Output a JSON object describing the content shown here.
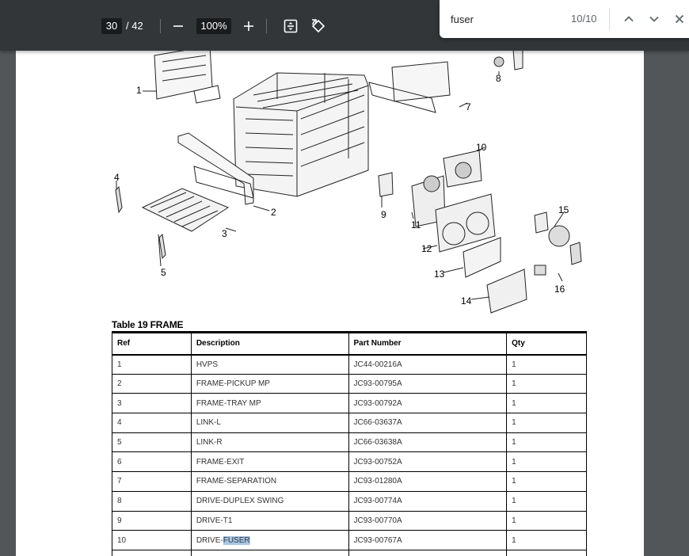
{
  "toolbar": {
    "page_current": "30",
    "page_total": "/ 42",
    "zoom": "100%",
    "icons": [
      "zoom-out-icon",
      "zoom-in-icon",
      "fit-page-icon",
      "rotate-icon"
    ]
  },
  "find": {
    "query": "fuser",
    "count": "10/10",
    "icons": [
      "chevron-up-icon",
      "chevron-down-icon",
      "close-icon"
    ]
  },
  "diagram": {
    "callouts": [
      "1",
      "2",
      "3",
      "4",
      "5",
      "7",
      "8",
      "9",
      "10",
      "11",
      "12",
      "13",
      "14",
      "15",
      "16"
    ]
  },
  "table": {
    "caption": "Table 19  FRAME",
    "headers": [
      "Ref",
      "Description",
      "Part Number",
      "Qty"
    ],
    "rows": [
      {
        "ref": "1",
        "desc": "HVPS",
        "part": "JC44-00216A",
        "qty": "1"
      },
      {
        "ref": "2",
        "desc": "FRAME-PICKUP MP",
        "part": "JC93-00795A",
        "qty": "1"
      },
      {
        "ref": "3",
        "desc": "FRAME-TRAY MP",
        "part": "JC93-00792A",
        "qty": "1"
      },
      {
        "ref": "4",
        "desc": "LINK-L",
        "part": "JC66-03637A",
        "qty": "1"
      },
      {
        "ref": "5",
        "desc": "LINK-R",
        "part": "JC66-03638A",
        "qty": "1"
      },
      {
        "ref": "6",
        "desc": "FRAME-EXIT",
        "part": "JC93-00752A",
        "qty": "1"
      },
      {
        "ref": "7",
        "desc": "FRAME-SEPARATION",
        "part": "JC93-01280A",
        "qty": "1"
      },
      {
        "ref": "8",
        "desc": "DRIVE-DUPLEX SWING",
        "part": "JC93-00774A",
        "qty": "1"
      },
      {
        "ref": "9",
        "desc": "DRIVE-T1",
        "part": "JC93-00770A",
        "qty": "1"
      },
      {
        "ref": "10",
        "desc_prefix": "DRIVE-",
        "desc_match": "FUSER",
        "part": "JC93-00767A",
        "qty": "1"
      }
    ]
  },
  "colors": {
    "toolbar_bg": "#323639",
    "viewer_bg": "#525659",
    "match_highlight": "#a8c7e6"
  }
}
